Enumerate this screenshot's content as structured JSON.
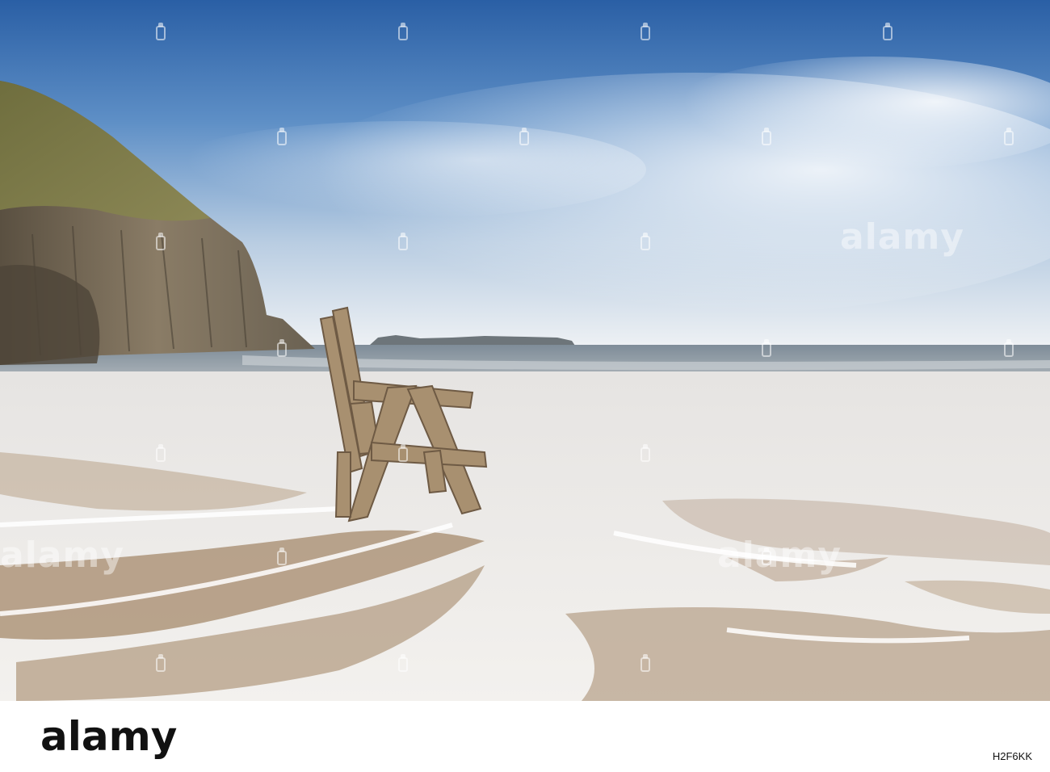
{
  "photo": {
    "subject": "wooden-chair-in-surf",
    "colors": {
      "sky_top": "#2f64a8",
      "sky_mid": "#7fa6cf",
      "sky_horizon": "#e9eef3",
      "sea": "#8e9aa4",
      "foam": "#f4f3f1",
      "wet_sand": "#a88e74",
      "cliff": "#6f6554",
      "grass": "#7d7a46",
      "chair_wood": "#a89070"
    }
  },
  "watermark": {
    "text": "alamy"
  },
  "footer": {
    "logo": "alamy",
    "image_id": "H2F6KK"
  }
}
